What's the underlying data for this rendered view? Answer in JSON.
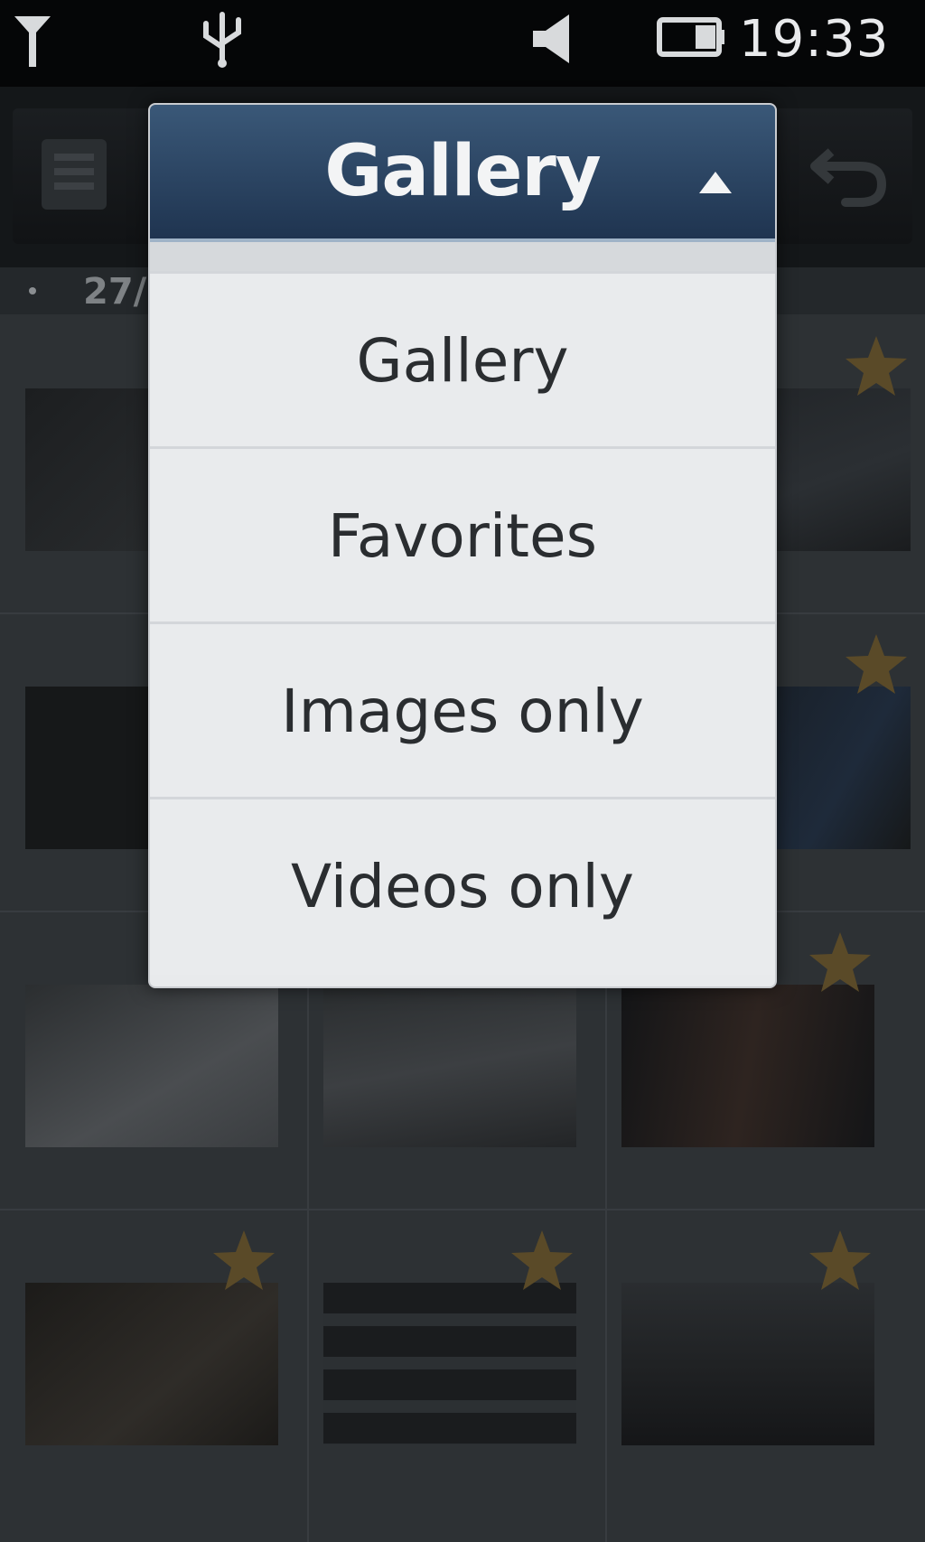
{
  "status_bar": {
    "time": "19:33",
    "icons": [
      "signal-icon",
      "usb-icon",
      "volume-icon",
      "battery-icon"
    ]
  },
  "header": {
    "date_label": "27/"
  },
  "dropdown": {
    "selected": "Gallery",
    "options": [
      {
        "label": "Gallery"
      },
      {
        "label": "Favorites"
      },
      {
        "label": "Images only"
      },
      {
        "label": "Videos only"
      }
    ]
  },
  "colors": {
    "dropdown_header": "#2b4463",
    "dropdown_bg": "#e8eaec",
    "star": "#5a4a28"
  }
}
